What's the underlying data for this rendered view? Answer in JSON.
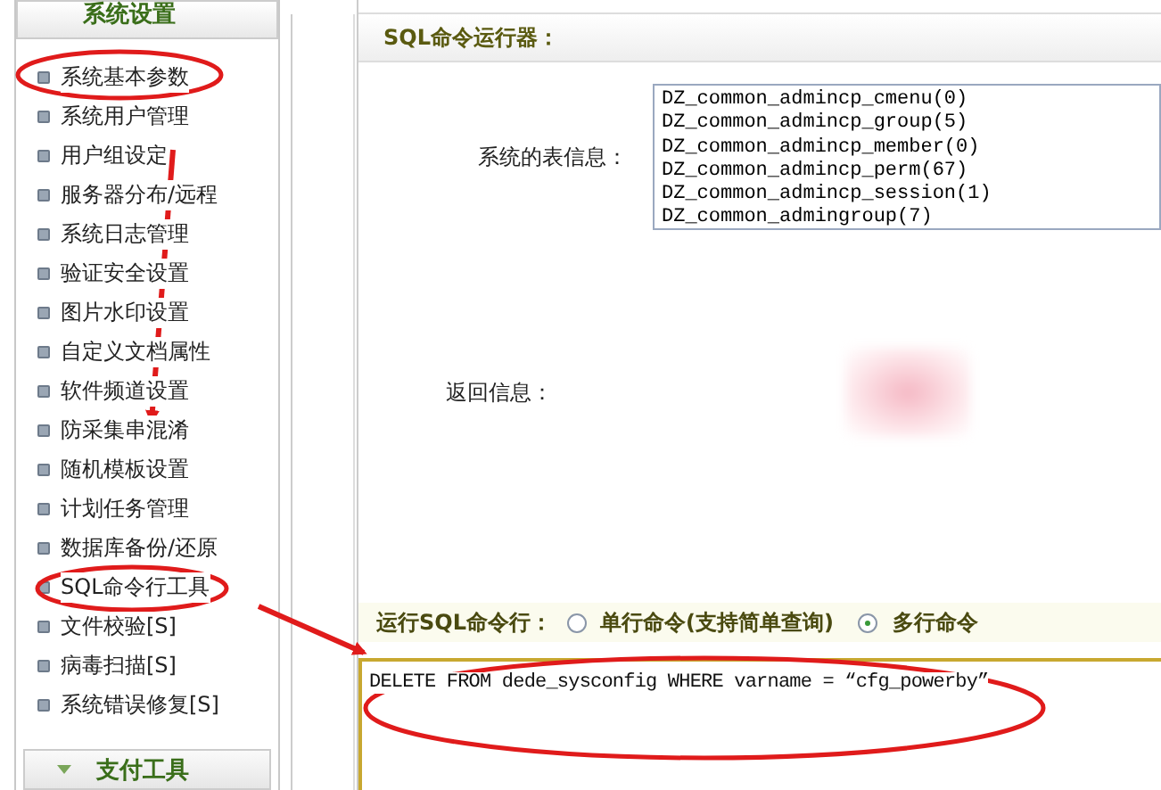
{
  "sidebar": {
    "header": "系统设置",
    "items": [
      {
        "label": "系统基本参数"
      },
      {
        "label": "系统用户管理"
      },
      {
        "label": "用户组设定"
      },
      {
        "label": "服务器分布/远程"
      },
      {
        "label": "系统日志管理"
      },
      {
        "label": "验证安全设置"
      },
      {
        "label": "图片水印设置"
      },
      {
        "label": "自定义文档属性"
      },
      {
        "label": "软件频道设置"
      },
      {
        "label": "防采集串混淆"
      },
      {
        "label": "随机模板设置"
      },
      {
        "label": "计划任务管理"
      },
      {
        "label": "数据库备份/还原"
      },
      {
        "label": "SQL命令行工具"
      },
      {
        "label": "文件校验[S]"
      },
      {
        "label": "病毒扫描[S]"
      },
      {
        "label": "系统错误修复[S]"
      }
    ],
    "footer": "支付工具"
  },
  "main": {
    "title": "SQL命令运行器：",
    "tables_label": "系统的表信息：",
    "tables": [
      "DZ_common_admincp_cmenu(0)",
      "DZ_common_admincp_group(5)",
      "DZ_common_admincp_member(0)",
      "DZ_common_admincp_perm(67)",
      "DZ_common_admincp_session(1)",
      "DZ_common_admingroup(7)"
    ],
    "result_label": "返回信息：",
    "run_label": "运行SQL命令行：",
    "modes": [
      {
        "label": "单行命令(支持简单查询)",
        "selected": false
      },
      {
        "label": "多行命令",
        "selected": true
      }
    ],
    "command": "DELETE FROM dede_sysconfig WHERE varname = “cfg_powerby”"
  }
}
